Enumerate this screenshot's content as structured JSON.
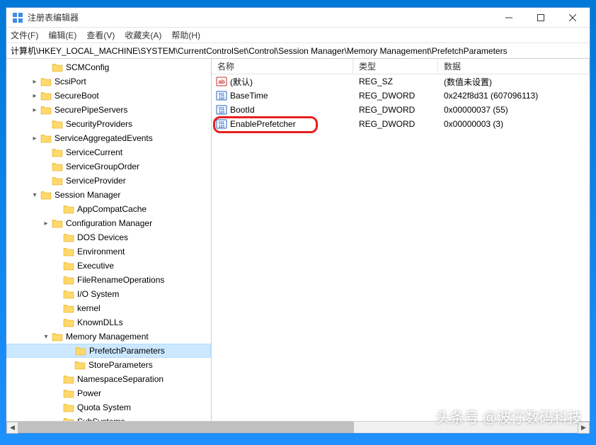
{
  "window": {
    "title": "注册表编辑器"
  },
  "menu": {
    "file": "文件(F)",
    "edit": "编辑(E)",
    "view": "查看(V)",
    "favorites": "收藏夹(A)",
    "help": "帮助(H)"
  },
  "addressbar": "计算机\\HKEY_LOCAL_MACHINE\\SYSTEM\\CurrentControlSet\\Control\\Session Manager\\Memory Management\\PrefetchParameters",
  "tree": [
    {
      "indent": 3,
      "exp": "",
      "label": "SCMConfig"
    },
    {
      "indent": 2,
      "exp": ">",
      "label": "ScsiPort"
    },
    {
      "indent": 2,
      "exp": ">",
      "label": "SecureBoot"
    },
    {
      "indent": 2,
      "exp": ">",
      "label": "SecurePipeServers"
    },
    {
      "indent": 3,
      "exp": "",
      "label": "SecurityProviders"
    },
    {
      "indent": 2,
      "exp": ">",
      "label": "ServiceAggregatedEvents"
    },
    {
      "indent": 3,
      "exp": "",
      "label": "ServiceCurrent"
    },
    {
      "indent": 3,
      "exp": "",
      "label": "ServiceGroupOrder"
    },
    {
      "indent": 3,
      "exp": "",
      "label": "ServiceProvider"
    },
    {
      "indent": 2,
      "exp": "v",
      "label": "Session Manager"
    },
    {
      "indent": 4,
      "exp": "",
      "label": "AppCompatCache"
    },
    {
      "indent": 3,
      "exp": ">",
      "label": "Configuration Manager"
    },
    {
      "indent": 4,
      "exp": "",
      "label": "DOS Devices"
    },
    {
      "indent": 4,
      "exp": "",
      "label": "Environment"
    },
    {
      "indent": 4,
      "exp": "",
      "label": "Executive"
    },
    {
      "indent": 4,
      "exp": "",
      "label": "FileRenameOperations"
    },
    {
      "indent": 4,
      "exp": "",
      "label": "I/O System"
    },
    {
      "indent": 4,
      "exp": "",
      "label": "kernel"
    },
    {
      "indent": 4,
      "exp": "",
      "label": "KnownDLLs"
    },
    {
      "indent": 3,
      "exp": "v",
      "label": "Memory Management"
    },
    {
      "indent": 5,
      "exp": "",
      "label": "PrefetchParameters",
      "selected": true
    },
    {
      "indent": 5,
      "exp": "",
      "label": "StoreParameters"
    },
    {
      "indent": 4,
      "exp": "",
      "label": "NamespaceSeparation"
    },
    {
      "indent": 4,
      "exp": "",
      "label": "Power"
    },
    {
      "indent": 4,
      "exp": "",
      "label": "Quota System"
    },
    {
      "indent": 4,
      "exp": "",
      "label": "SubSystems"
    }
  ],
  "list": {
    "columns": {
      "name": "名称",
      "type": "类型",
      "data": "数据"
    },
    "rows": [
      {
        "icon": "str",
        "name": "(默认)",
        "type": "REG_SZ",
        "data": "(数值未设置)"
      },
      {
        "icon": "bin",
        "name": "BaseTime",
        "type": "REG_DWORD",
        "data": "0x242f8d31 (607096113)"
      },
      {
        "icon": "bin",
        "name": "BootId",
        "type": "REG_DWORD",
        "data": "0x00000037 (55)"
      },
      {
        "icon": "bin",
        "name": "EnablePrefetcher",
        "type": "REG_DWORD",
        "data": "0x00000003 (3)",
        "highlight": true
      }
    ]
  },
  "watermark": "头条号 @波仔数码科技"
}
